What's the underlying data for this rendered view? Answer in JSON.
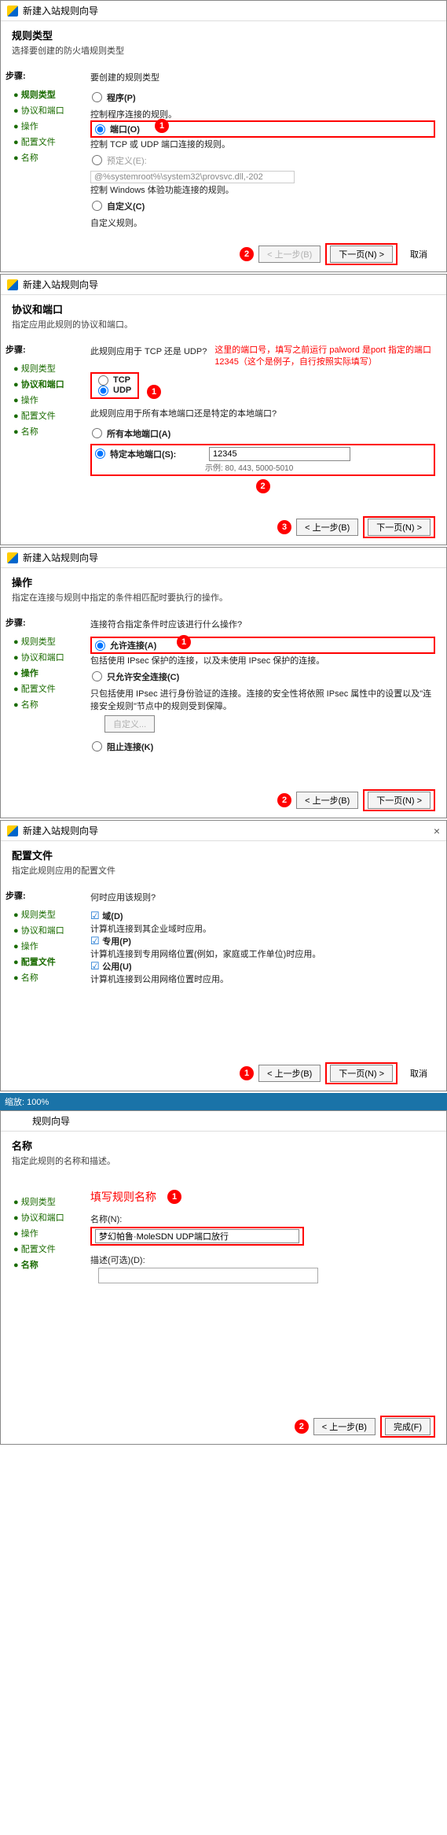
{
  "wizard_title": "新建入站规则向导",
  "steps_label": "步骤:",
  "steps": [
    "规则类型",
    "协议和端口",
    "操作",
    "配置文件",
    "名称"
  ],
  "btn_back": "< 上一步(B)",
  "btn_next": "下一页(N) >",
  "btn_cancel": "取消",
  "btn_finish": "完成(F)",
  "p1": {
    "title": "规则类型",
    "sub": "选择要创建的防火墙规则类型",
    "q": "要创建的规则类型",
    "opt_program": "程序(P)",
    "opt_program_sub": "控制程序连接的规则。",
    "opt_port": "端口(O)",
    "opt_port_sub": "控制 TCP 或 UDP 端口连接的规则。",
    "opt_predef": "预定义(E):",
    "opt_predef_val": "@%systemroot%\\system32\\provsvc.dll,-202",
    "opt_predef_sub": "控制 Windows 体验功能连接的规则。",
    "opt_custom": "自定义(C)",
    "opt_custom_sub": "自定义规则。"
  },
  "p2": {
    "title": "协议和端口",
    "sub": "指定应用此规则的协议和端口。",
    "q1": "此规则应用于 TCP 还是 UDP?",
    "opt_tcp": "TCP",
    "opt_udp": "UDP",
    "q2": "此规则应用于所有本地端口还是特定的本地端口?",
    "opt_all": "所有本地端口(A)",
    "opt_spec": "特定本地端口(S):",
    "port_value": "12345",
    "port_example": "示例:   80,   443,   5000-5010",
    "note": "这里的端口号，填写之前运行 palword 是port 指定的端口 12345（这个是例子，自行按照实际填写）"
  },
  "p3": {
    "title": "操作",
    "sub": "指定在连接与规则中指定的条件相匹配时要执行的操作。",
    "q": "连接符合指定条件时应该进行什么操作?",
    "opt_allow": "允许连接(A)",
    "opt_allow_sub": "包括使用 IPsec 保护的连接，以及未使用 IPsec 保护的连接。",
    "opt_sec": "只允许安全连接(C)",
    "opt_sec_sub": "只包括使用 IPsec 进行身份验证的连接。连接的安全性将依照 IPsec 属性中的设置以及\"连接安全规则\"节点中的规则受到保障。",
    "btn_custom": "自定义...",
    "opt_block": "阻止连接(K)"
  },
  "p4": {
    "title": "配置文件",
    "sub": "指定此规则应用的配置文件",
    "q": "何时应用该规则?",
    "d": "域(D)",
    "d_sub": "计算机连接到其企业域时应用。",
    "pr": "专用(P)",
    "pr_sub": "计算机连接到专用网络位置(例如，家庭或工作单位)时应用。",
    "pu": "公用(U)",
    "pu_sub": "计算机连接到公用网络位置时应用。"
  },
  "p5": {
    "status": "缩放: 100%",
    "title": "名称",
    "sub": "指定此规则的名称和描述。",
    "note": "填写规则名称",
    "name_lbl": "名称(N):",
    "name_val": "梦幻帕鲁·MoleSDN UDP端口放行",
    "desc_lbl": "描述(可选)(D):"
  }
}
